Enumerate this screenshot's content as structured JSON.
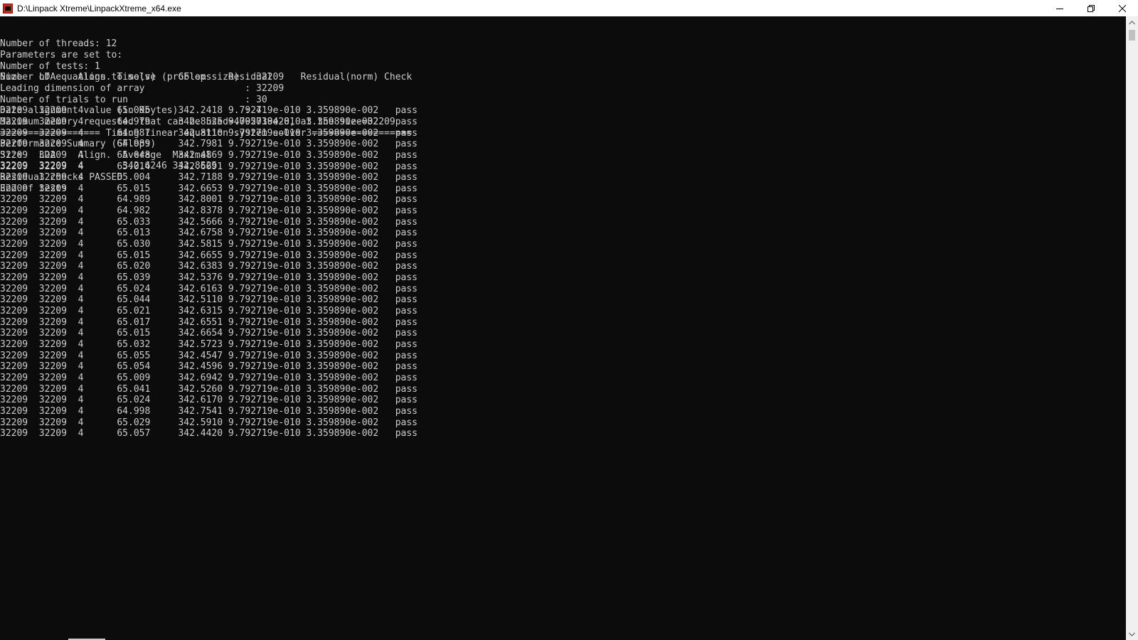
{
  "window": {
    "title": "D:\\Linpack Xtreme\\LinpackXtreme_x64.exe",
    "controls": {
      "minimize_icon": "minimize-icon",
      "restore_icon": "restore-icon",
      "close_icon": "close-icon"
    }
  },
  "console": {
    "header_lines": [
      "Number of threads: 12",
      "",
      "Parameters are set to:",
      "",
      "Number of tests: 1",
      "Number of equations to solve (problem size) : 32209",
      "Leading dimension of array                  : 32209",
      "Number of trials to run                     : 30",
      "Data alignment value (in Kbytes)            : 4",
      "",
      "Maximum memory requested that can be used=4005038428, at the size=32209",
      "",
      "================== Timing linear equation system solver ==================",
      ""
    ],
    "table_header": "Size   LDA    Align. Time(s)    GFlops   Residual     Residual(norm) Check",
    "rows": [
      "32209  32209  4      65.095     342.2418 9.792719e-010 3.359890e-002   pass",
      "32209  32209  4      64.979     342.8525 9.792719e-010 3.359890e-002   pass",
      "32209  32209  4      64.987     342.8110 9.792719e-010 3.359890e-002   pass",
      "32209  32209  4      64.989     342.7981 9.792719e-010 3.359890e-002   pass",
      "32209  32209  4      65.048     342.4869 9.792719e-010 3.359890e-002   pass",
      "32209  32209  4      65.014     342.6691 9.792719e-010 3.359890e-002   pass",
      "32209  32209  4      65.004     342.7188 9.792719e-010 3.359890e-002   pass",
      "32209  32209  4      65.015     342.6653 9.792719e-010 3.359890e-002   pass",
      "32209  32209  4      64.989     342.8001 9.792719e-010 3.359890e-002   pass",
      "32209  32209  4      64.982     342.8378 9.792719e-010 3.359890e-002   pass",
      "32209  32209  4      65.033     342.5666 9.792719e-010 3.359890e-002   pass",
      "32209  32209  4      65.013     342.6758 9.792719e-010 3.359890e-002   pass",
      "32209  32209  4      65.030     342.5815 9.792719e-010 3.359890e-002   pass",
      "32209  32209  4      65.015     342.6655 9.792719e-010 3.359890e-002   pass",
      "32209  32209  4      65.020     342.6383 9.792719e-010 3.359890e-002   pass",
      "32209  32209  4      65.039     342.5376 9.792719e-010 3.359890e-002   pass",
      "32209  32209  4      65.024     342.6163 9.792719e-010 3.359890e-002   pass",
      "32209  32209  4      65.044     342.5110 9.792719e-010 3.359890e-002   pass",
      "32209  32209  4      65.021     342.6315 9.792719e-010 3.359890e-002   pass",
      "32209  32209  4      65.017     342.6551 9.792719e-010 3.359890e-002   pass",
      "32209  32209  4      65.015     342.6654 9.792719e-010 3.359890e-002   pass",
      "32209  32209  4      65.032     342.5723 9.792719e-010 3.359890e-002   pass",
      "32209  32209  4      65.055     342.4547 9.792719e-010 3.359890e-002   pass",
      "32209  32209  4      65.054     342.4596 9.792719e-010 3.359890e-002   pass",
      "32209  32209  4      65.009     342.6942 9.792719e-010 3.359890e-002   pass",
      "32209  32209  4      65.041     342.5260 9.792719e-010 3.359890e-002   pass",
      "32209  32209  4      65.024     342.6170 9.792719e-010 3.359890e-002   pass",
      "32209  32209  4      64.998     342.7541 9.792719e-010 3.359890e-002   pass",
      "32209  32209  4      65.029     342.5910 9.792719e-010 3.359890e-002   pass",
      "32209  32209  4      65.057     342.4420 9.792719e-010 3.359890e-002   pass"
    ],
    "footer_lines": [
      "",
      "Performance Summary (GFlops)",
      "",
      "Size   LDA    Align.  Average  Maximal",
      "32209  32209  4       342.6246 342.8525",
      "",
      "Residual checks PASSED",
      "",
      "End of tests"
    ]
  },
  "scrollbar": {
    "up_icon": "scroll-up-arrow-icon",
    "down_icon": "scroll-down-arrow-icon"
  },
  "colors": {
    "console_bg": "#0c0c0c",
    "console_fg": "#cccccc",
    "titlebar_bg": "#ffffff",
    "icon_red": "#c42b1c"
  }
}
